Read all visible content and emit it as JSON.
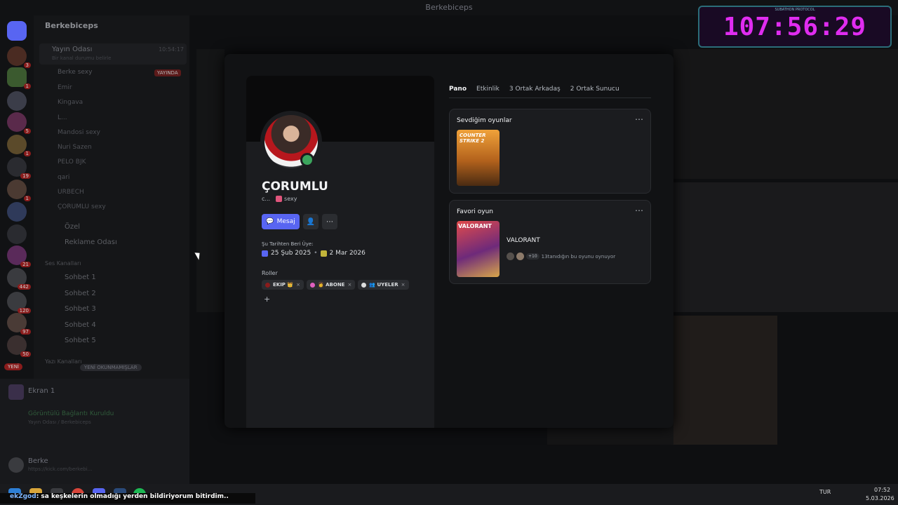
{
  "window": {
    "title": "Berkebiceps"
  },
  "timer": {
    "header": "SUBATHON PROTOCOL",
    "value": "107:56:29"
  },
  "sidebar": {
    "server_name": "Berkebiceps",
    "voice_channel": {
      "name": "Yayın Odası",
      "time": "10:54:17",
      "desc": "Bir kanal durumu belirle"
    },
    "members": [
      {
        "name": "Berke",
        "tag": "sexy",
        "live": "YAYINDA"
      },
      {
        "name": "Emir"
      },
      {
        "name": "Kingava"
      },
      {
        "name": "L..."
      },
      {
        "name": "Mandosi",
        "tag": "sexy"
      },
      {
        "name": "Nuri Sazen"
      },
      {
        "name": "PELO",
        "tag": "BJK"
      },
      {
        "name": "qari"
      },
      {
        "name": "URBECH"
      },
      {
        "name": "ÇORUMLU",
        "tag": "sexy"
      }
    ],
    "channels": [
      "Özel",
      "Reklame Odası"
    ],
    "voice_header": "Ses Kanalları",
    "voice_channels": [
      "Sohbet 1",
      "Sohbet 2",
      "Sohbet 3",
      "Sohbet 4",
      "Sohbet 5"
    ],
    "text_header": "Yazı Kanalları",
    "new_unread": "YENİ OKUNMAMIŞLAR",
    "new_badge": "YENİ",
    "screen_share": "Ekran 1",
    "connection": {
      "status": "Görüntülü Bağlantı Kuruldu",
      "location": "Yayın Odası / Berkebiceps"
    },
    "user": {
      "name": "Berke",
      "status": "https://kick.com/berkebi..."
    }
  },
  "server_badges": [
    "3",
    "1",
    "5",
    "1",
    "19",
    "1",
    "21",
    "442",
    "120",
    "97",
    "50"
  ],
  "profile": {
    "username": "ÇORUMLU",
    "sub_name": "c...",
    "sub_tag": "sexy",
    "message_button": "Mesaj",
    "member_since_label": "Şu Tarihten Beri Üye:",
    "discord_date": "25 Şub 2025",
    "server_date": "2 Mar 2026",
    "roles_label": "Roller",
    "roles": [
      {
        "name": "EKIP 👑",
        "color": "#8a1c1c"
      },
      {
        "name": "👩 ABONE",
        "color": "#e060c0"
      },
      {
        "name": "👥 UYELER",
        "color": "#dcddde"
      }
    ],
    "add_role": "+"
  },
  "tabs": [
    {
      "label": "Pano",
      "active": true
    },
    {
      "label": "Etkinlik"
    },
    {
      "label": "3 Ortak Arkadaş"
    },
    {
      "label": "2 Ortak Sunucu"
    }
  ],
  "favorite_games": {
    "title": "Sevdiğim oyunlar",
    "game_logo": "COUNTER STRIKE 2"
  },
  "favorite_game": {
    "title": "Favori oyun",
    "logo": "VALORANT",
    "name": "VALORANT",
    "friend_count": "+10",
    "friends_text": "13tanıdığın bu oyunu oynuyor"
  },
  "ticker": {
    "user": "ekZgod",
    "message": ": sa keşkelerin olmadığı yerden bildiriyorum bitirdim.."
  },
  "tray": {
    "lang": "TUR",
    "time": "07:52",
    "date": "5.03.2026"
  }
}
